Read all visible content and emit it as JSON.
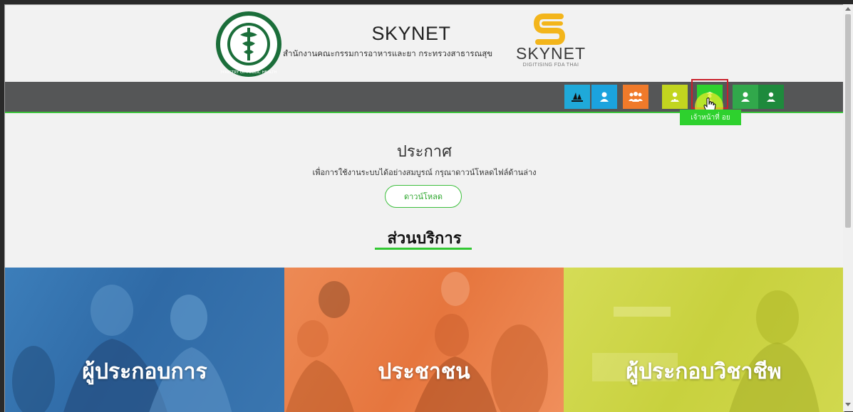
{
  "header": {
    "title": "SKYNET",
    "subtitle": "สำนักงานคณะกรรมการอาหารและยา กระทรวงสาธารณสุข",
    "brand_word": "SKYNET",
    "brand_tagline": "DIGITISING FDA THAI",
    "emblem_icon": "ministry-of-public-health-emblem",
    "brand_icon": "skynet-s-logo"
  },
  "navbar": {
    "items": [
      {
        "icon": "sailboat-icon",
        "color": "#1fa9d9"
      },
      {
        "icon": "person-icon",
        "color": "#1ba3de"
      },
      {
        "icon": "group-icon",
        "color": "#f07a2a"
      },
      {
        "icon": "doctor-icon",
        "color": "#c2d51f"
      },
      {
        "icon": "officer-icon",
        "color": "#2ed12e",
        "selected": true
      },
      {
        "icon": "person-icon",
        "color": "#31a84b"
      },
      {
        "icon": "doctor-icon",
        "color": "#1e8a3c"
      }
    ],
    "tooltip": "เจ้าหน้าที่ อย"
  },
  "announcement": {
    "title": "ประกาศ",
    "description": "เพื่อการใช้งานระบบได้อย่างสมบูรณ์ กรุณาดาวน์โหลดไฟล์ด้านล่าง",
    "download_label": "ดาวน์โหลด"
  },
  "services": {
    "title": "ส่วนบริการ",
    "panels": [
      {
        "label": "ผู้ประกอบการ",
        "color": "#3a78b5"
      },
      {
        "label": "ประชาชน",
        "color": "#ec8249"
      },
      {
        "label": "ผู้ประกอบวิชาชีพ",
        "color": "#cfd649"
      }
    ]
  },
  "colors": {
    "accent_green": "#3cc33c",
    "navbar_bg": "#555657",
    "selection_border": "#c9202b"
  }
}
